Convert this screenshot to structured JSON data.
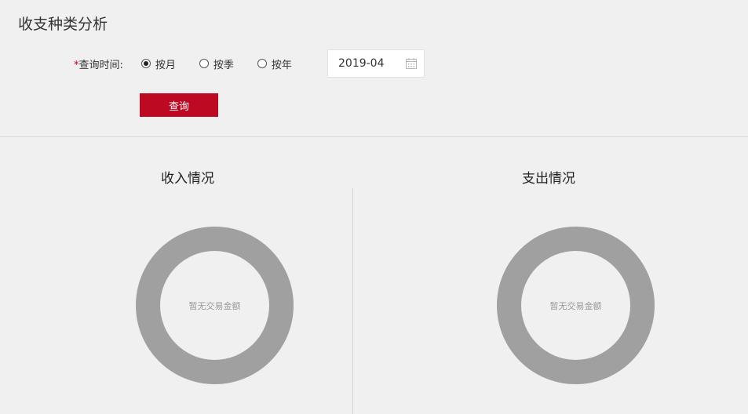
{
  "header": {
    "title": "收支种类分析"
  },
  "query": {
    "required_mark": "*",
    "label": "查询时间:",
    "options": [
      {
        "label": "按月",
        "checked": true
      },
      {
        "label": "按季",
        "checked": false
      },
      {
        "label": "按年",
        "checked": false
      }
    ],
    "date_value": "2019-04",
    "button_label": "查询"
  },
  "sections": {
    "income": {
      "title": "收入情况",
      "empty_text": "暂无交易金额"
    },
    "expense": {
      "title": "支出情况",
      "empty_text": "暂无交易金额"
    }
  },
  "colors": {
    "accent": "#bd0a22",
    "ring": "#a0a0a0",
    "background": "#f0f0f0"
  },
  "icons": {
    "date_picker": "calendar-icon"
  }
}
